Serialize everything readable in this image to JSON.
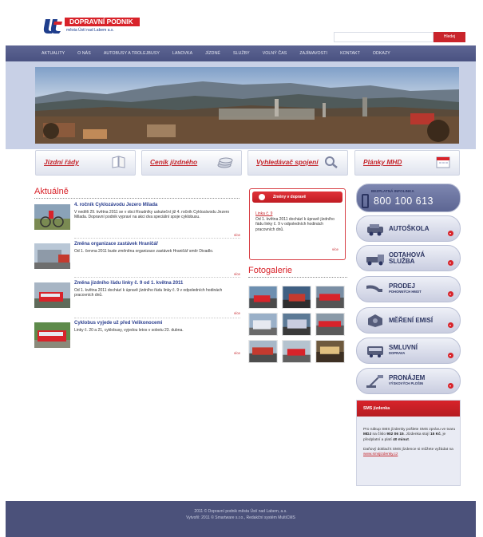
{
  "header": {
    "logo_title": "DOPRAVNÍ PODNIK",
    "logo_subtitle": "města Ústí nad Labem a.s.",
    "search_placeholder": "",
    "search_button": "Hledej"
  },
  "nav": {
    "items": [
      "AKTUALITY",
      "O NÁS",
      "AUTOBUSY A TROLEJBUSY",
      "LANOVKA",
      "JÍZDNÉ",
      "SLUŽBY",
      "VOLNÝ ČAS",
      "ZAJÍMAVOSTI",
      "KONTAKT",
      "ODKAZY"
    ]
  },
  "quick_links": [
    {
      "label": "Jízdní řády",
      "icon": "book-icon"
    },
    {
      "label": "Ceník jízdného",
      "icon": "coins-icon"
    },
    {
      "label": "Vyhledávač spojení",
      "icon": "magnifier-icon"
    },
    {
      "label": "Plánky MHD",
      "icon": "calendar-icon"
    }
  ],
  "news": {
    "title": "Aktuálně",
    "more_label": "více",
    "items": [
      {
        "heading": "4. ročník Cyklozávodu Jezero Milada",
        "text": "V neděli 29. května 2011 se v obci Roudníky uskuteční již 4. ročník Cyklozávodu Jezero Milada. Dopravní podnik vypraví na akci dva speciální spoje cyklobusu."
      },
      {
        "heading": "Změna organizace zastávek Hraničář",
        "text": "Od 1. června 2011 bude změněna organizace zastávek Hraničář směr Divadlo."
      },
      {
        "heading": "Změna jízdního řádu linky č. 9 od 1. května 2011",
        "text": "Od 1. května 2011 dochází k úpravě jízdního řádu linky č. 9 v odpoledních hodinách pracovních dnů."
      },
      {
        "heading": "Cyklobus vyjede už před Velikonocemi",
        "text": "Linky č. 20 a 21, cyklobusy, vyjedou letos v sobotu 23. dubna."
      }
    ]
  },
  "changes": {
    "title": "Změny v dopravě",
    "link": "Linka č. 9",
    "text": "Od 1. května 2011 dochází k úpravě jízdního řádu linky č. 9 v odpoledních hodinách pracovních dnů.",
    "more_label": "více"
  },
  "gallery": {
    "title": "Fotogalerie"
  },
  "infoline": {
    "label": "BEZPLATNÁ INFOLINKA",
    "number": "800 100 613"
  },
  "services": [
    {
      "label": "AUTOŠKOLA",
      "small": "",
      "icon": "car-icon"
    },
    {
      "label": "ODTAHOVÁ",
      "label2": "SLUŽBA",
      "small": "",
      "icon": "tow-truck-icon"
    },
    {
      "label": "PRODEJ",
      "small": "POHONNÝCH HMOT",
      "icon": "fuel-nozzle-icon"
    },
    {
      "label": "MĚŘENÍ EMISÍ",
      "small": "",
      "icon": "emission-icon"
    },
    {
      "label": "SMLUVNÍ",
      "small": "DOPRAVA",
      "icon": "bus-icon"
    },
    {
      "label": "PRONÁJEM",
      "small": "VÝSKOVÝCH PLOŠIN",
      "icon": "lift-platform-icon"
    }
  ],
  "sms": {
    "title": "SMS jízdenka",
    "text1_a": "Pro nákup SMS jízdenky pošlete SMS zprávu ve tvaru ",
    "text1_code": "MDJ",
    "text1_b": " na číslo ",
    "text1_number": "902 06 15",
    "text1_c": ". Jízdenka stojí ",
    "text1_price": "15 Kč",
    "text1_d": ", je předplatní a platí ",
    "text1_time": "40 minut",
    "text1_e": ".",
    "text2": "Daňový doklad k SMS jízdence si můžete vyžádat na",
    "link": "www.smsjizdenky.cz"
  },
  "footer": {
    "line1": "2011 © Dopravní podnik města Ústí nad Labem, a.s.",
    "line2": "Vytvořil: 2011 © Smartware s.r.o., Redakční systém MultiCMS"
  },
  "colors": {
    "brand_red": "#d8232a",
    "nav_blue": "#4a5281",
    "link_blue": "#2b3f8f"
  }
}
